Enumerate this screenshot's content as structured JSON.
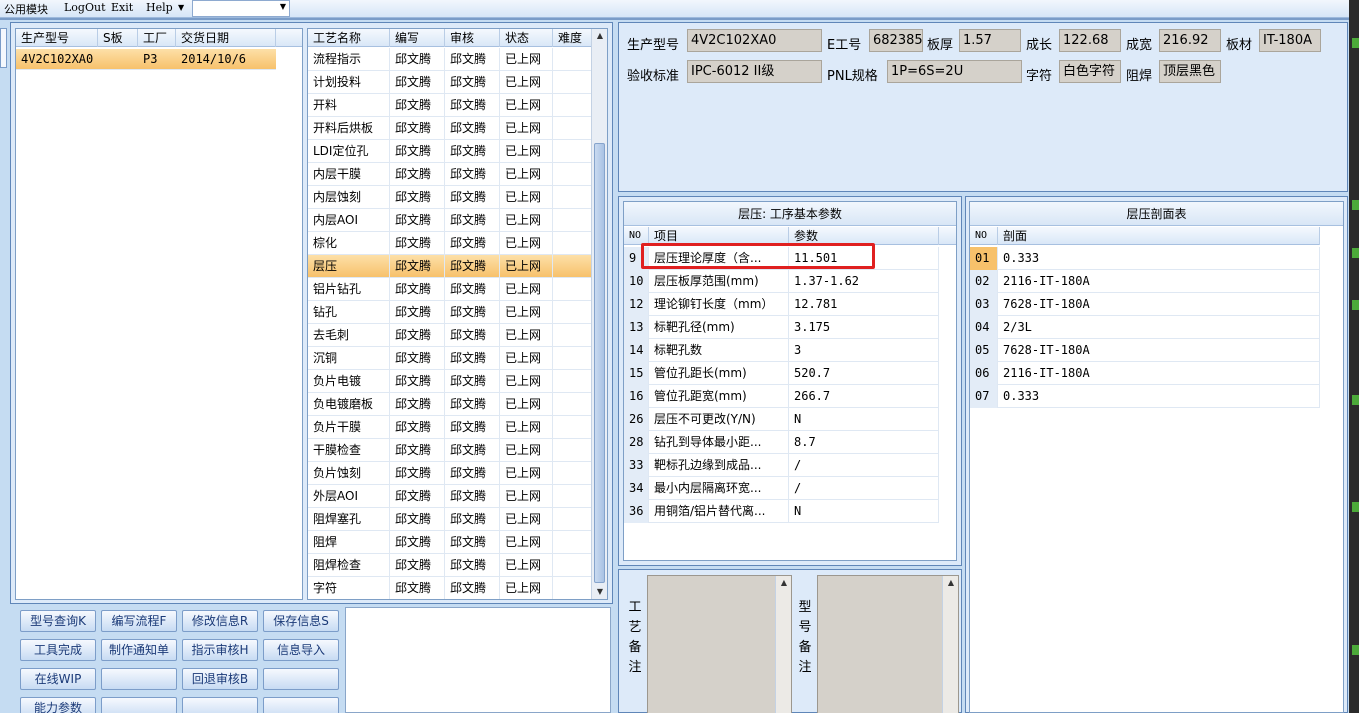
{
  "menu": [
    "公用模块",
    "LogOut",
    "Exit",
    "Help"
  ],
  "header": {
    "labels": {
      "part_no": "生产型号",
      "e_no": "E工号",
      "thickness": "板厚",
      "length": "成长",
      "width": "成宽",
      "material": "板材",
      "standard": "验收标准",
      "pnl": "PNL规格",
      "char": "字符",
      "mask": "阻焊"
    },
    "values": {
      "part_no": "4V2C102XA0",
      "e_no": "682385",
      "thickness": "1.57",
      "length": "122.68",
      "width": "216.92",
      "material": "IT-180A",
      "standard": "IPC-6012 II级",
      "pnl": "1P=6S=2U",
      "char": "白色字符",
      "mask": "顶层黑色"
    }
  },
  "parts": {
    "columns": [
      "生产型号",
      "S板",
      "工厂",
      "交货日期"
    ],
    "rows": [
      [
        "4V2C102XA0",
        "",
        "P3",
        "2014/10/6"
      ]
    ]
  },
  "process": {
    "columns": [
      "工艺名称",
      "编写",
      "审核",
      "状态",
      "难度"
    ],
    "selected_index": 9,
    "rows": [
      [
        "流程指示",
        "邱文腾",
        "邱文腾",
        "已上网"
      ],
      [
        "计划投料",
        "邱文腾",
        "邱文腾",
        "已上网"
      ],
      [
        "开料",
        "邱文腾",
        "邱文腾",
        "已上网"
      ],
      [
        "开料后烘板",
        "邱文腾",
        "邱文腾",
        "已上网"
      ],
      [
        "LDI定位孔",
        "邱文腾",
        "邱文腾",
        "已上网"
      ],
      [
        "内层干膜",
        "邱文腾",
        "邱文腾",
        "已上网"
      ],
      [
        "内层蚀刻",
        "邱文腾",
        "邱文腾",
        "已上网"
      ],
      [
        "内层AOI",
        "邱文腾",
        "邱文腾",
        "已上网"
      ],
      [
        "棕化",
        "邱文腾",
        "邱文腾",
        "已上网"
      ],
      [
        "层压",
        "邱文腾",
        "邱文腾",
        "已上网"
      ],
      [
        "铝片钻孔",
        "邱文腾",
        "邱文腾",
        "已上网"
      ],
      [
        "钻孔",
        "邱文腾",
        "邱文腾",
        "已上网"
      ],
      [
        "去毛刺",
        "邱文腾",
        "邱文腾",
        "已上网"
      ],
      [
        "沉铜",
        "邱文腾",
        "邱文腾",
        "已上网"
      ],
      [
        "负片电镀",
        "邱文腾",
        "邱文腾",
        "已上网"
      ],
      [
        "负电镀磨板",
        "邱文腾",
        "邱文腾",
        "已上网"
      ],
      [
        "负片干膜",
        "邱文腾",
        "邱文腾",
        "已上网"
      ],
      [
        "干膜检查",
        "邱文腾",
        "邱文腾",
        "已上网"
      ],
      [
        "负片蚀刻",
        "邱文腾",
        "邱文腾",
        "已上网"
      ],
      [
        "外层AOI",
        "邱文腾",
        "邱文腾",
        "已上网"
      ],
      [
        "阻焊塞孔",
        "邱文腾",
        "邱文腾",
        "已上网"
      ],
      [
        "阻焊",
        "邱文腾",
        "邱文腾",
        "已上网"
      ],
      [
        "阻焊检查",
        "邱文腾",
        "邱文腾",
        "已上网"
      ],
      [
        "字符",
        "邱文腾",
        "邱文腾",
        "已上网"
      ]
    ]
  },
  "params": {
    "caption": "层压: 工序基本参数",
    "columns": [
      "NO",
      "项目",
      "参数"
    ],
    "rows": [
      [
        "9",
        "层压理论厚度（含...",
        "11.501"
      ],
      [
        "10",
        "层压板厚范围(mm)",
        "1.37-1.62"
      ],
      [
        "12",
        "理论铆钉长度（mm）",
        "12.781"
      ],
      [
        "13",
        "标靶孔径(mm)",
        "3.175"
      ],
      [
        "14",
        "标靶孔数",
        "3"
      ],
      [
        "15",
        "管位孔距长(mm)",
        "520.7"
      ],
      [
        "16",
        "管位孔距宽(mm)",
        "266.7"
      ],
      [
        "26",
        "层压不可更改(Y/N)",
        "N"
      ],
      [
        "28",
        "钻孔到导体最小距...",
        "8.7"
      ],
      [
        "33",
        "靶标孔边缘到成品...",
        "/"
      ],
      [
        "34",
        "最小内层隔离环宽...",
        "/"
      ],
      [
        "36",
        "用铜箔/铝片替代离...",
        "N"
      ]
    ]
  },
  "stackup": {
    "caption": "层压剖面表",
    "columns": [
      "NO",
      "剖面"
    ],
    "rows": [
      [
        "01",
        "0.333"
      ],
      [
        "02",
        "2116-IT-180A"
      ],
      [
        "03",
        "7628-IT-180A"
      ],
      [
        "04",
        "2/3L"
      ],
      [
        "05",
        "7628-IT-180A"
      ],
      [
        "06",
        "2116-IT-180A"
      ],
      [
        "07",
        "0.333"
      ]
    ]
  },
  "notes": {
    "process_label": "工艺备注",
    "part_label": "型号备注"
  },
  "buttons": [
    "型号查询K",
    "编写流程F",
    "修改信息R",
    "保存信息S",
    "工具完成",
    "制作通知单",
    "指示审核H",
    "信息导入",
    "在线WIP",
    "",
    "回退审核B",
    "",
    "能力参数",
    "",
    "",
    ""
  ],
  "colors": {
    "selection": "#f7c16b",
    "highlight": "#e02020",
    "panel": "#ddeaf9",
    "field": "#d5d1ca"
  }
}
